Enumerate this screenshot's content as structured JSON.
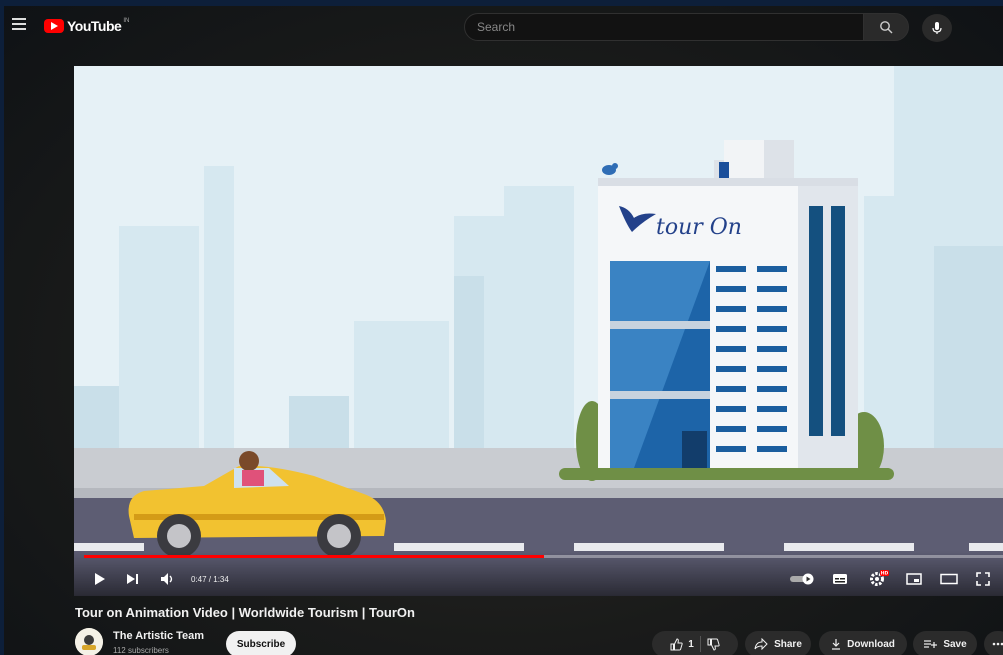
{
  "header": {
    "logo_text": "YouTube",
    "logo_country": "IN",
    "search_placeholder": "Search"
  },
  "player": {
    "time_display": "0:47 / 1:34",
    "progress_fraction": 0.5,
    "settings_badge": "HD",
    "scene_brand_text": "tour On"
  },
  "video": {
    "title": "Tour on Animation Video | Worldwide Tourism | TourOn"
  },
  "channel": {
    "name": "The Artistic Team",
    "subscribers": "112 subscribers",
    "subscribe_label": "Subscribe"
  },
  "actions": {
    "like_count": "1",
    "share_label": "Share",
    "download_label": "Download",
    "save_label": "Save"
  },
  "colors": {
    "accent_red": "#ff0000",
    "brand_blue": "#1b4f9b",
    "car_yellow": "#f2c230"
  }
}
